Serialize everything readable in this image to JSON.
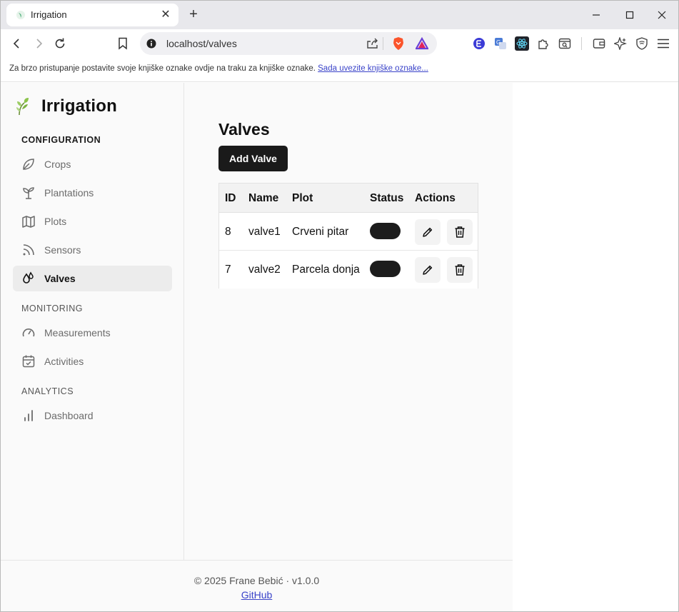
{
  "browser": {
    "tab_title": "Irrigation",
    "tab_close": "✕",
    "new_tab": "+",
    "url": "localhost/valves",
    "bookmark_bar_text": "Za brzo pristupanje postavite svoje knjiške oznake ovdje na traku za knjiške oznake.",
    "bookmark_bar_link": "Sada uvezite knjiške oznake..."
  },
  "app": {
    "brand": "Irrigation",
    "sections": {
      "configuration": "CONFIGURATION",
      "monitoring": "MONITORING",
      "analytics": "ANALYTICS"
    },
    "nav": {
      "crops": "Crops",
      "plantations": "Plantations",
      "plots": "Plots",
      "sensors": "Sensors",
      "valves": "Valves",
      "measurements": "Measurements",
      "activities": "Activities",
      "dashboard": "Dashboard"
    },
    "active_nav": "valves"
  },
  "page": {
    "title": "Valves",
    "add_button": "Add Valve",
    "table": {
      "headers": [
        "ID",
        "Name",
        "Plot",
        "Status",
        "Actions"
      ],
      "rows": [
        {
          "id": "8",
          "name": "valve1",
          "plot": "Crveni pitar",
          "status_on": true
        },
        {
          "id": "7",
          "name": "valve2",
          "plot": "Parcela donja",
          "status_on": true
        }
      ]
    }
  },
  "footer": {
    "copyright": "© 2025 Frane Bebić · v1.0.0",
    "github": "GitHub"
  },
  "colors": {
    "accent_dark": "#1a1a1a",
    "link": "#3a43c9",
    "brand_leaf": "#7cb342"
  }
}
